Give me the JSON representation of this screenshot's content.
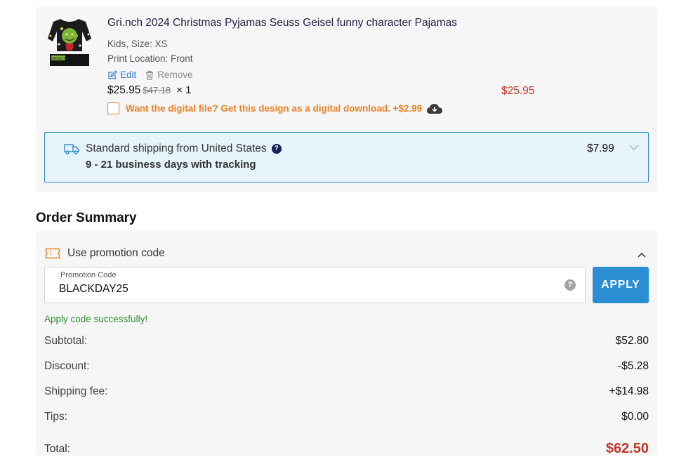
{
  "cart_item": {
    "title": "Gri.nch 2024 Christmas Pyjamas Seuss Geisel funny character Pajamas",
    "variant": "Kids, Size: XS",
    "print_location": "Print Location: Front",
    "edit_label": "Edit",
    "remove_label": "Remove",
    "price": "$25.95",
    "original_price": "$47.18",
    "quantity": "× 1",
    "line_total": "$25.95",
    "digital_offer": "Want the digital file? Get this design as a digital download. +$2.99",
    "thumbnail_text": "GRINCH",
    "icons": {
      "edit": "edit-icon",
      "remove": "trash-icon",
      "download": "cloud-download-icon"
    }
  },
  "shipping": {
    "title": "Standard shipping from United States",
    "help_icon_text": "?",
    "days": "9 - 21 business days with tracking",
    "price": "$7.99",
    "icons": {
      "truck": "truck-icon",
      "expand": "chevron-down-icon"
    }
  },
  "order_summary": {
    "title": "Order Summary",
    "promo_label": "Use promotion code",
    "promo_field_label": "Promotion Code",
    "promo_value": "BLACKDAY25",
    "help_icon_text": "?",
    "apply_label": "APPLY",
    "success_message": "Apply code successfully!",
    "rows": [
      {
        "label": "Subtotal:",
        "value": "$52.80"
      },
      {
        "label": "Discount:",
        "value": "-$5.28"
      },
      {
        "label": "Shipping fee:",
        "value": "+$14.98"
      },
      {
        "label": "Tips:",
        "value": "$0.00"
      }
    ],
    "total_label": "Total:",
    "total_value": "$62.50",
    "icons": {
      "ticket": "ticket-icon",
      "collapse": "chevron-up-icon"
    }
  },
  "colors": {
    "accent_blue": "#2b8ed3",
    "price_red": "#c0392b",
    "offer_orange": "#e8832a",
    "success_green": "#2f8f2f",
    "shipping_bg": "#e6f3fb"
  }
}
